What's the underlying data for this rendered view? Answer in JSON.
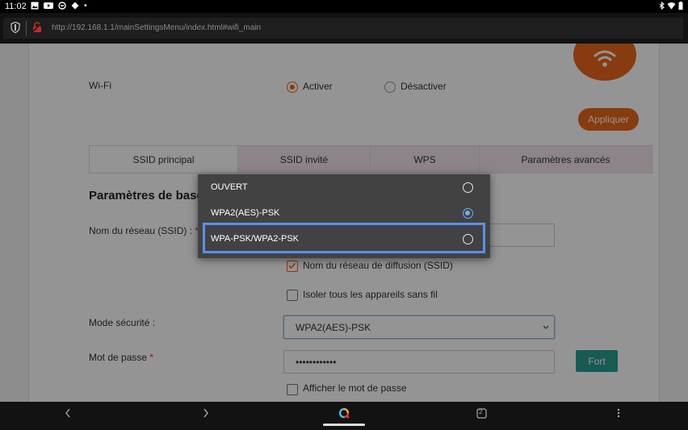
{
  "status_bar": {
    "time": "11:02",
    "dot": "•"
  },
  "browser": {
    "url": "http://192.168.1.1/mainSettingsMenu/index.html#wifi_main"
  },
  "wifi": {
    "label": "Wi-Fi",
    "enable_label": "Activer",
    "disable_label": "Désactiver",
    "enabled": true
  },
  "apply_label": "Appliquer",
  "tabs": [
    {
      "label": "SSID principal",
      "active": true
    },
    {
      "label": "SSID invité",
      "active": false
    },
    {
      "label": "WPS",
      "active": false
    },
    {
      "label": "Paramètres avancés",
      "active": false
    }
  ],
  "section_title": "Paramètres de base",
  "ssid_label": "Nom du réseau (SSID) :",
  "required_mark": "*",
  "broadcast_ssid": {
    "label": "Nom du réseau de diffusion (SSID)",
    "checked": true
  },
  "isolate_devices": {
    "label": "Isoler tous les appareils sans fil",
    "checked": false
  },
  "security_mode": {
    "label": "Mode sécurité :",
    "value": "WPA2(AES)-PSK"
  },
  "password": {
    "label": "Mot de passe",
    "value": "••••••••••••",
    "strength": "Fort"
  },
  "show_password": {
    "label": "Afficher le mot de passe",
    "checked": false
  },
  "dropdown": {
    "options": [
      {
        "label": "OUVERT",
        "selected": false
      },
      {
        "label": "WPA2(AES)-PSK",
        "selected": true
      },
      {
        "label": "WPA-PSK/WPA2-PSK",
        "selected": false
      }
    ],
    "focused_index": 2
  },
  "nav": {
    "tab_count": "2"
  },
  "colors": {
    "accent": "#e8661a",
    "strength": "#2a9d8f",
    "focus": "#5d8fe8",
    "radio_selected": "#74aef0"
  }
}
